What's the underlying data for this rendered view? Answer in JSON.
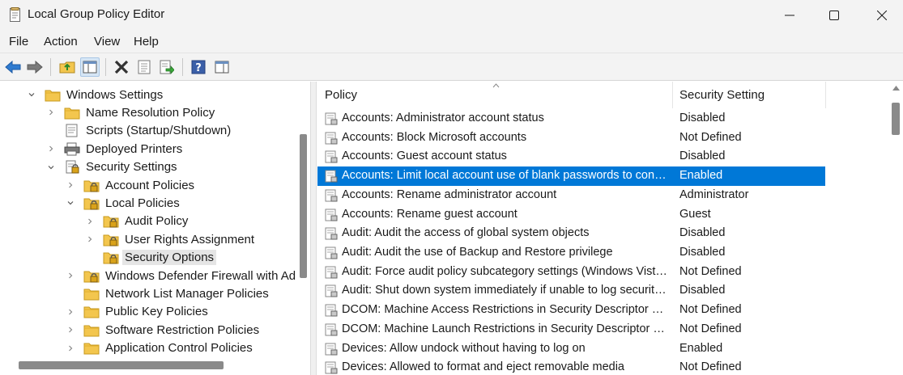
{
  "window": {
    "title": "Local Group Policy Editor",
    "icon": "policy-editor-icon"
  },
  "menu": [
    "File",
    "Action",
    "View",
    "Help"
  ],
  "toolbar": [
    "back-arrow-icon",
    "forward-arrow-icon",
    "up-folder-icon",
    "show-hide-tree-icon",
    "delete-icon",
    "properties-icon",
    "export-list-icon",
    "help-icon",
    "show-hide-action-pane-icon"
  ],
  "tree": {
    "items": [
      {
        "label": "Windows Settings",
        "level": 0,
        "expanded": true,
        "icon": "folder-icon"
      },
      {
        "label": "Name Resolution Policy",
        "level": 1,
        "expanded": false,
        "icon": "folder-icon"
      },
      {
        "label": "Scripts (Startup/Shutdown)",
        "level": 1,
        "expanded": null,
        "icon": "scripts-icon"
      },
      {
        "label": "Deployed Printers",
        "level": 1,
        "expanded": false,
        "icon": "printer-icon"
      },
      {
        "label": "Security Settings",
        "level": 1,
        "expanded": true,
        "icon": "security-settings-icon"
      },
      {
        "label": "Account Policies",
        "level": 2,
        "expanded": false,
        "icon": "lock-folder-icon"
      },
      {
        "label": "Local Policies",
        "level": 2,
        "expanded": true,
        "icon": "lock-folder-icon"
      },
      {
        "label": "Audit Policy",
        "level": 3,
        "expanded": false,
        "icon": "lock-folder-icon"
      },
      {
        "label": "User Rights Assignment",
        "level": 3,
        "expanded": false,
        "icon": "lock-folder-icon"
      },
      {
        "label": "Security Options",
        "level": 3,
        "expanded": null,
        "icon": "lock-folder-icon",
        "selected": true
      },
      {
        "label": "Windows Defender Firewall with Adva",
        "level": 2,
        "expanded": false,
        "icon": "lock-folder-icon"
      },
      {
        "label": "Network List Manager Policies",
        "level": 2,
        "expanded": null,
        "icon": "folder-icon"
      },
      {
        "label": "Public Key Policies",
        "level": 2,
        "expanded": false,
        "icon": "folder-icon"
      },
      {
        "label": "Software Restriction Policies",
        "level": 2,
        "expanded": false,
        "icon": "folder-icon"
      },
      {
        "label": "Application Control Policies",
        "level": 2,
        "expanded": false,
        "icon": "folder-icon"
      }
    ]
  },
  "list": {
    "columns": [
      "Policy",
      "Security Setting"
    ],
    "rows": [
      {
        "policy": "Accounts: Administrator account status",
        "setting": "Disabled"
      },
      {
        "policy": "Accounts: Block Microsoft accounts",
        "setting": "Not Defined"
      },
      {
        "policy": "Accounts: Guest account status",
        "setting": "Disabled"
      },
      {
        "policy": "Accounts: Limit local account use of blank passwords to console logon only",
        "setting": "Enabled",
        "selected": true
      },
      {
        "policy": "Accounts: Rename administrator account",
        "setting": "Administrator"
      },
      {
        "policy": "Accounts: Rename guest account",
        "setting": "Guest"
      },
      {
        "policy": "Audit: Audit the access of global system objects",
        "setting": "Disabled"
      },
      {
        "policy": "Audit: Audit the use of Backup and Restore privilege",
        "setting": "Disabled"
      },
      {
        "policy": "Audit: Force audit policy subcategory settings (Windows Vista or later) to override audit policy category settings",
        "setting": "Not Defined"
      },
      {
        "policy": "Audit: Shut down system immediately if unable to log security audits",
        "setting": "Disabled"
      },
      {
        "policy": "DCOM: Machine Access Restrictions in Security Descriptor Definition Language (SDDL) syntax",
        "setting": "Not Defined"
      },
      {
        "policy": "DCOM: Machine Launch Restrictions in Security Descriptor Definition Language (SDDL) syntax",
        "setting": "Not Defined"
      },
      {
        "policy": "Devices: Allow undock without having to log on",
        "setting": "Enabled"
      },
      {
        "policy": "Devices: Allowed to format and eject removable media",
        "setting": "Not Defined"
      }
    ]
  },
  "colors": {
    "selection": "#0078d7",
    "chrome": "#f3f3f3",
    "folder": "#f3c64e"
  }
}
